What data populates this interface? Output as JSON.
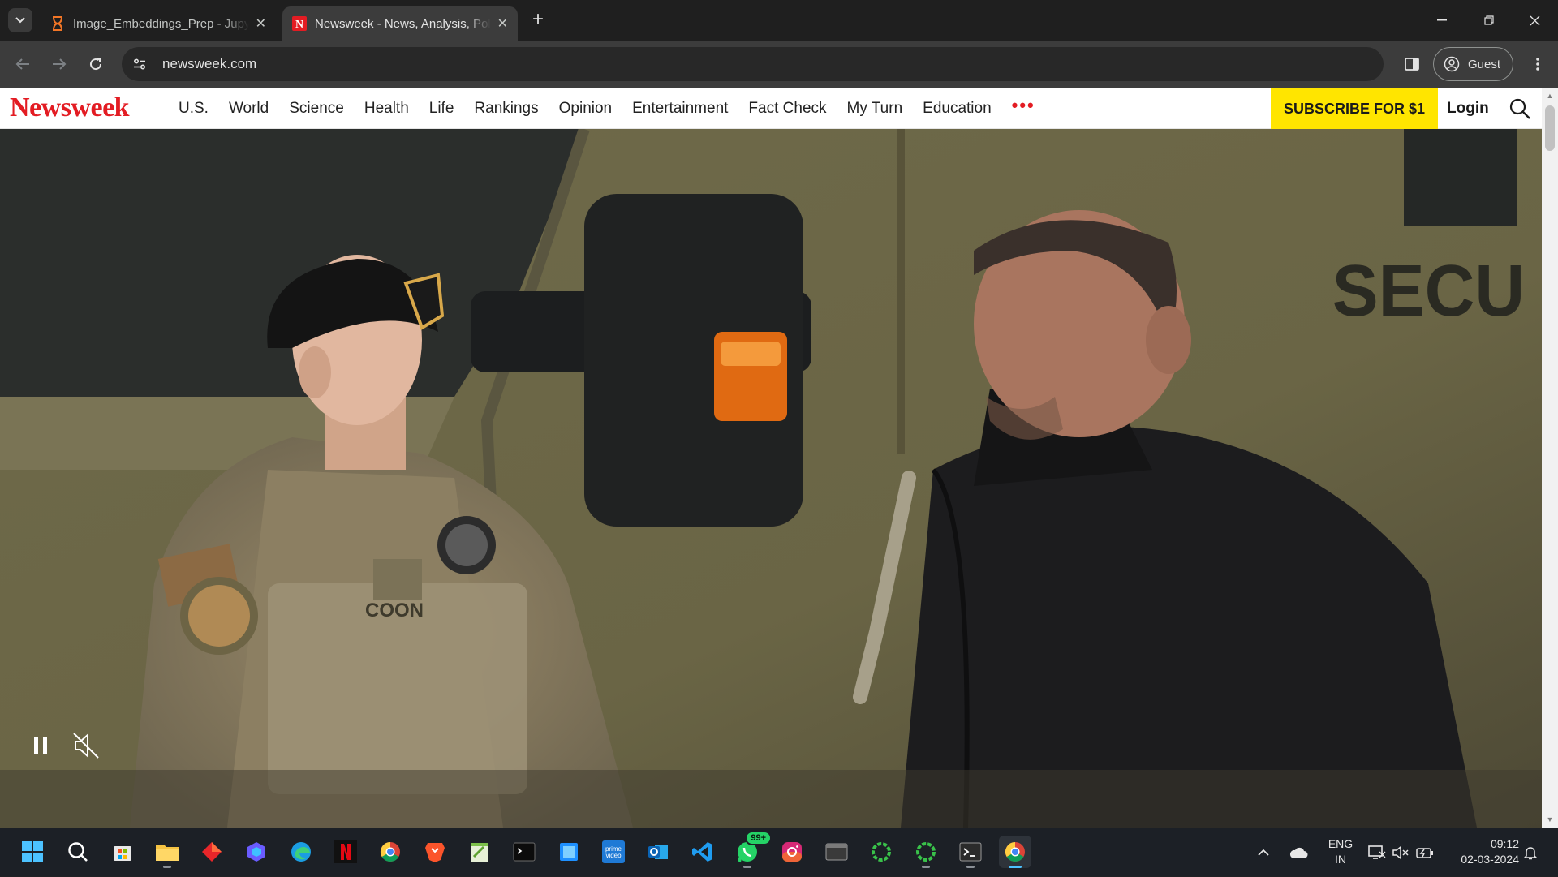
{
  "browser": {
    "tabs": [
      {
        "title": "Image_Embeddings_Prep - Jupyter",
        "active": false,
        "icon": "hourglass-icon"
      },
      {
        "title": "Newsweek - News, Analysis, Politics",
        "active": true,
        "icon": "newsweek-favicon"
      }
    ],
    "url": "newsweek.com",
    "profile_label": "Guest"
  },
  "site": {
    "logo": "Newsweek",
    "nav": [
      "U.S.",
      "World",
      "Science",
      "Health",
      "Life",
      "Rankings",
      "Opinion",
      "Entertainment",
      "Fact Check",
      "My Turn",
      "Education"
    ],
    "more": "•••",
    "subscribe_label": "SUBSCRIBE FOR $1",
    "login_label": "Login",
    "brand_color": "#e31c23",
    "subscribe_color": "#ffe500"
  },
  "video": {
    "state": "playing",
    "muted": true,
    "vehicle_text": "SECU",
    "name_tape": "COON"
  },
  "taskbar": {
    "apps": [
      "start-icon",
      "search-icon",
      "store-icon",
      "file-explorer-icon",
      "app-red-icon",
      "copilot-icon",
      "edge-icon",
      "netflix-icon",
      "chrome-icon",
      "brave-icon",
      "notepad-icon",
      "terminal-icon",
      "app-blue-icon",
      "prime-video-icon",
      "outlook-icon",
      "vscode-icon",
      "whatsapp-icon",
      "instagram-icon",
      "window-app-icon",
      "ring-app-icon",
      "ring-app-icon-2",
      "cmd-icon",
      "chrome-active-icon"
    ],
    "whatsapp_badge": "99+",
    "language": "ENG",
    "region": "IN",
    "time": "09:12",
    "date": "02-03-2024"
  }
}
